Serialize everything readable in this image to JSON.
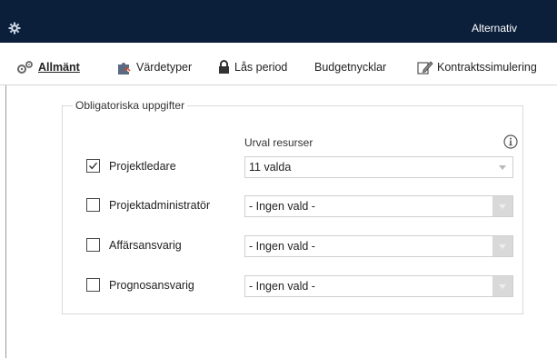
{
  "window": {
    "title": "Alternativ"
  },
  "toolbar": {
    "items": [
      {
        "label": "Allmänt",
        "icon": "gears-icon"
      },
      {
        "label": "Värdetyper",
        "icon": "puzzle-icon"
      },
      {
        "label": "Lås period",
        "icon": "lock-icon"
      },
      {
        "label": "Budgetnycklar",
        "icon": ""
      },
      {
        "label": "Kontraktssimulering",
        "icon": "edit-icon"
      }
    ]
  },
  "group": {
    "legend": "Obligatoriska uppgifter",
    "column_header": "Urval resurser",
    "info_icon": "info-icon",
    "rows": [
      {
        "label": "Projektledare",
        "checked": true,
        "value": "11 valda"
      },
      {
        "label": "Projektadministratör",
        "checked": false,
        "value": "- Ingen vald -"
      },
      {
        "label": "Affärsansvarig",
        "checked": false,
        "value": "- Ingen vald -"
      },
      {
        "label": "Prognosansvarig",
        "checked": false,
        "value": "- Ingen vald -"
      }
    ]
  },
  "colors": {
    "titlebar": "#0b1e3a",
    "disabled_arrow": "#d9d9d9"
  }
}
